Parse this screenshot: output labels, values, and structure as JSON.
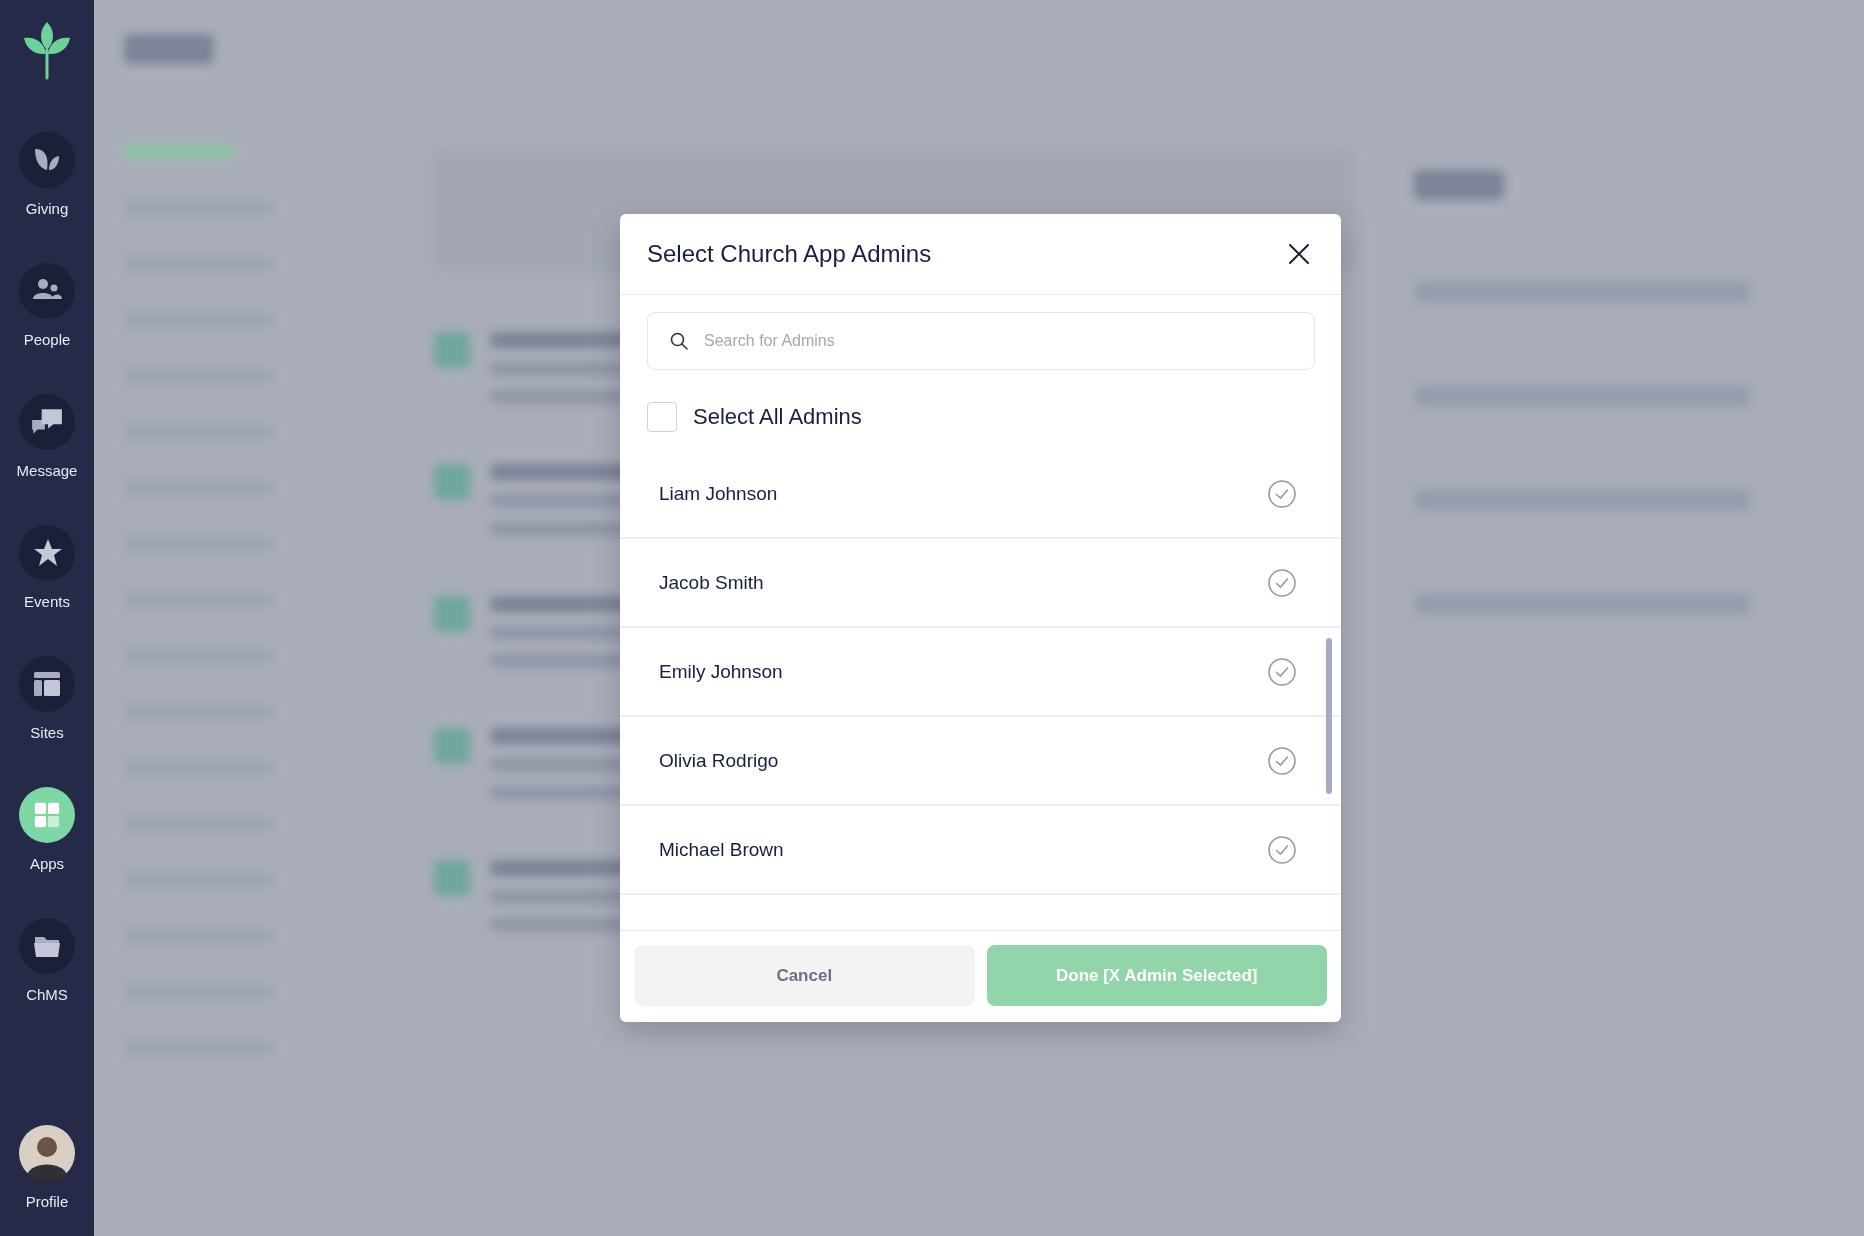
{
  "sidebar": {
    "items": [
      {
        "label": "Giving",
        "kind": "giving",
        "selected": false
      },
      {
        "label": "People",
        "kind": "people",
        "selected": false
      },
      {
        "label": "Message",
        "kind": "message",
        "selected": false
      },
      {
        "label": "Events",
        "kind": "events",
        "selected": false
      },
      {
        "label": "Sites",
        "kind": "sites",
        "selected": false
      },
      {
        "label": "Apps",
        "kind": "apps",
        "selected": true
      },
      {
        "label": "ChMS",
        "kind": "chms",
        "selected": false
      }
    ],
    "profile": {
      "label": "Profile"
    }
  },
  "dialog": {
    "title": "Select Church App Admins",
    "search": {
      "placeholder": "Search for Admins"
    },
    "select_all": {
      "label": "Select All Admins",
      "checked": false
    },
    "admins": [
      {
        "name": "Liam Johnson",
        "checked": false
      },
      {
        "name": "Jacob Smith",
        "checked": false
      },
      {
        "name": "Emily Johnson",
        "checked": false
      },
      {
        "name": "Olivia Rodrigo",
        "checked": false
      },
      {
        "name": "Michael Brown",
        "checked": false
      }
    ],
    "buttons": [
      {
        "label": "Cancel",
        "kind": "secondary"
      },
      {
        "label": "Done [X Admin Selected]",
        "kind": "primary"
      }
    ]
  }
}
